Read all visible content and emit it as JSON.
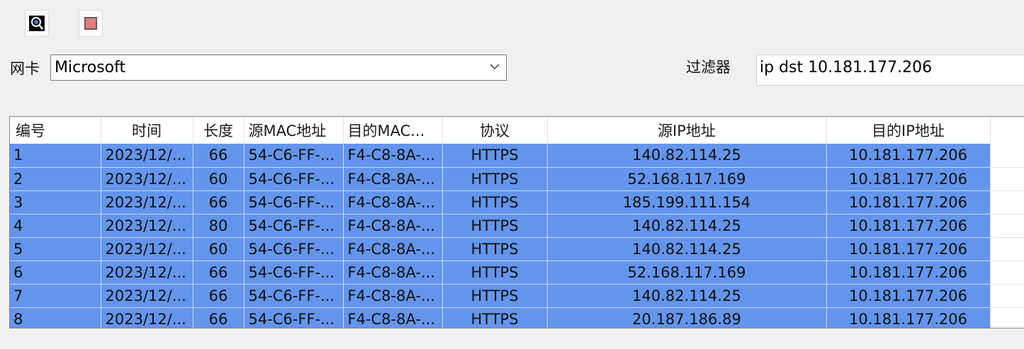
{
  "toolbar": {
    "start_icon": "capture-start-icon",
    "stop_icon": "capture-stop-icon",
    "stop_color": "#e57f7f"
  },
  "nic": {
    "label": "网卡",
    "selected": "Microsoft"
  },
  "filter": {
    "label": "过滤器",
    "value": "ip dst 10.181.177.206"
  },
  "table": {
    "selection_color": "#6495ed",
    "columns": [
      "编号",
      "时间",
      "长度",
      "源MAC地址",
      "目的MAC...",
      "协议",
      "源IP地址",
      "目的IP地址"
    ],
    "rows": [
      [
        "1",
        "2023/12/...",
        "66",
        "54-C6-FF-...",
        "F4-C8-8A-...",
        "HTTPS",
        "140.82.114.25",
        "10.181.177.206"
      ],
      [
        "2",
        "2023/12/...",
        "60",
        "54-C6-FF-...",
        "F4-C8-8A-...",
        "HTTPS",
        "52.168.117.169",
        "10.181.177.206"
      ],
      [
        "3",
        "2023/12/...",
        "66",
        "54-C6-FF-...",
        "F4-C8-8A-...",
        "HTTPS",
        "185.199.111.154",
        "10.181.177.206"
      ],
      [
        "4",
        "2023/12/...",
        "80",
        "54-C6-FF-...",
        "F4-C8-8A-...",
        "HTTPS",
        "140.82.114.25",
        "10.181.177.206"
      ],
      [
        "5",
        "2023/12/...",
        "60",
        "54-C6-FF-...",
        "F4-C8-8A-...",
        "HTTPS",
        "140.82.114.25",
        "10.181.177.206"
      ],
      [
        "6",
        "2023/12/...",
        "66",
        "54-C6-FF-...",
        "F4-C8-8A-...",
        "HTTPS",
        "52.168.117.169",
        "10.181.177.206"
      ],
      [
        "7",
        "2023/12/...",
        "66",
        "54-C6-FF-...",
        "F4-C8-8A-...",
        "HTTPS",
        "140.82.114.25",
        "10.181.177.206"
      ],
      [
        "8",
        "2023/12/...",
        "66",
        "54-C6-FF-...",
        "F4-C8-8A-...",
        "HTTPS",
        "20.187.186.89",
        "10.181.177.206"
      ]
    ]
  }
}
